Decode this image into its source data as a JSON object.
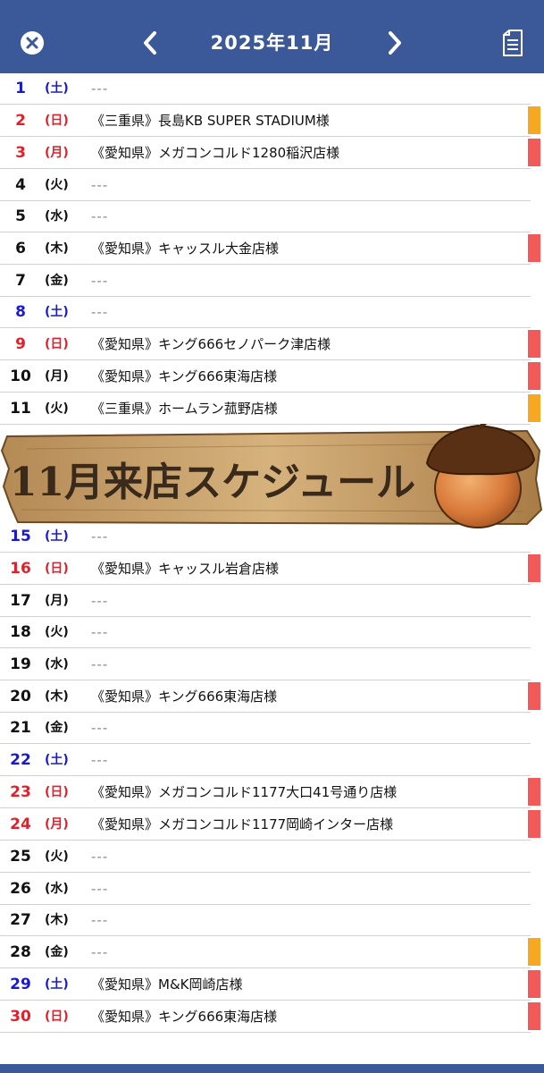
{
  "header": {
    "title": "2025年11月",
    "close_icon": "close-icon",
    "prev_icon": "chevron-left-icon",
    "next_icon": "chevron-right-icon",
    "doc_icon": "document-icon"
  },
  "colors": {
    "header_bg": "#3b5998",
    "saturday": "#1a1acc",
    "sunday": "#e0202a",
    "weekday": "#111111",
    "orange": "#f7a823",
    "red": "#f25a5a"
  },
  "banner": {
    "text": "11月来店スケジュール",
    "icon": "acorn-icon"
  },
  "rows": [
    {
      "day": "1",
      "wd": "(土)",
      "type": "sat",
      "event": "---",
      "bar": ""
    },
    {
      "day": "2",
      "wd": "(日)",
      "type": "sun",
      "event": "《三重県》長島KB SUPER STADIUM様",
      "bar": "orange"
    },
    {
      "day": "3",
      "wd": "(月)",
      "type": "sun",
      "event": "《愛知県》メガコンコルド1280稲沢店様",
      "bar": "red"
    },
    {
      "day": "4",
      "wd": "(火)",
      "type": "wk",
      "event": "---",
      "bar": ""
    },
    {
      "day": "5",
      "wd": "(水)",
      "type": "wk",
      "event": "---",
      "bar": ""
    },
    {
      "day": "6",
      "wd": "(木)",
      "type": "wk",
      "event": "《愛知県》キャッスル大金店様",
      "bar": "red"
    },
    {
      "day": "7",
      "wd": "(金)",
      "type": "wk",
      "event": "---",
      "bar": ""
    },
    {
      "day": "8",
      "wd": "(土)",
      "type": "sat",
      "event": "---",
      "bar": ""
    },
    {
      "day": "9",
      "wd": "(日)",
      "type": "sun",
      "event": "《愛知県》キング666セノパーク津店様",
      "bar": "red"
    },
    {
      "day": "10",
      "wd": "(月)",
      "type": "wk",
      "event": "《愛知県》キング666東海店様",
      "bar": "red"
    },
    {
      "day": "11",
      "wd": "(火)",
      "type": "wk",
      "event": "《三重県》ホームラン菰野店様",
      "bar": "orange"
    },
    {
      "day": "15",
      "wd": "(土)",
      "type": "sat",
      "event": "---",
      "bar": ""
    },
    {
      "day": "16",
      "wd": "(日)",
      "type": "sun",
      "event": "《愛知県》キャッスル岩倉店様",
      "bar": "red"
    },
    {
      "day": "17",
      "wd": "(月)",
      "type": "wk",
      "event": "---",
      "bar": ""
    },
    {
      "day": "18",
      "wd": "(火)",
      "type": "wk",
      "event": "---",
      "bar": ""
    },
    {
      "day": "19",
      "wd": "(水)",
      "type": "wk",
      "event": "---",
      "bar": ""
    },
    {
      "day": "20",
      "wd": "(木)",
      "type": "wk",
      "event": "《愛知県》キング666東海店様",
      "bar": "red"
    },
    {
      "day": "21",
      "wd": "(金)",
      "type": "wk",
      "event": "---",
      "bar": ""
    },
    {
      "day": "22",
      "wd": "(土)",
      "type": "sat",
      "event": "---",
      "bar": ""
    },
    {
      "day": "23",
      "wd": "(日)",
      "type": "sun",
      "event": "《愛知県》メガコンコルド1177大口41号通り店様",
      "bar": "red"
    },
    {
      "day": "24",
      "wd": "(月)",
      "type": "sun",
      "event": "《愛知県》メガコンコルド1177岡崎インター店様",
      "bar": "red"
    },
    {
      "day": "25",
      "wd": "(火)",
      "type": "wk",
      "event": "---",
      "bar": ""
    },
    {
      "day": "26",
      "wd": "(水)",
      "type": "wk",
      "event": "---",
      "bar": ""
    },
    {
      "day": "27",
      "wd": "(木)",
      "type": "wk",
      "event": "---",
      "bar": ""
    },
    {
      "day": "28",
      "wd": "(金)",
      "type": "wk",
      "event": "---",
      "bar": "orange"
    },
    {
      "day": "29",
      "wd": "(土)",
      "type": "sat",
      "event": "《愛知県》M&K岡崎店様",
      "bar": "red"
    },
    {
      "day": "30",
      "wd": "(日)",
      "type": "sun",
      "event": "《愛知県》キング666東海店様",
      "bar": "red"
    }
  ]
}
